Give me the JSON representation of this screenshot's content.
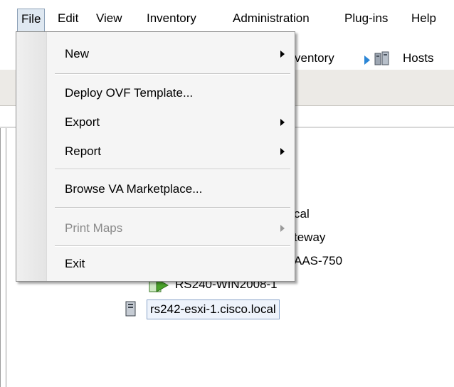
{
  "menubar": {
    "items": [
      "File",
      "Edit",
      "View",
      "Inventory",
      "Administration",
      "Plug-ins",
      "Help"
    ]
  },
  "nav": {
    "inventory_partial": "ventory",
    "hosts_partial": "Hosts"
  },
  "tree": {
    "partial_1": "cal",
    "partial_2": "teway",
    "partial_3": "AAS-750",
    "vm_label": "RS240-WIN2008-1",
    "host_label": "rs242-esxi-1.cisco.local"
  },
  "file_menu": {
    "new": "New",
    "deploy_ovf": "Deploy OVF Template...",
    "export": "Export",
    "report": "Report",
    "browse_va": "Browse VA Marketplace...",
    "print_maps": "Print Maps",
    "exit": "Exit"
  },
  "colors": {
    "menu_active_bg": "#dfe8f1",
    "nav_arrow": "#2b86d6",
    "vm_icon": "#4aa32b"
  }
}
